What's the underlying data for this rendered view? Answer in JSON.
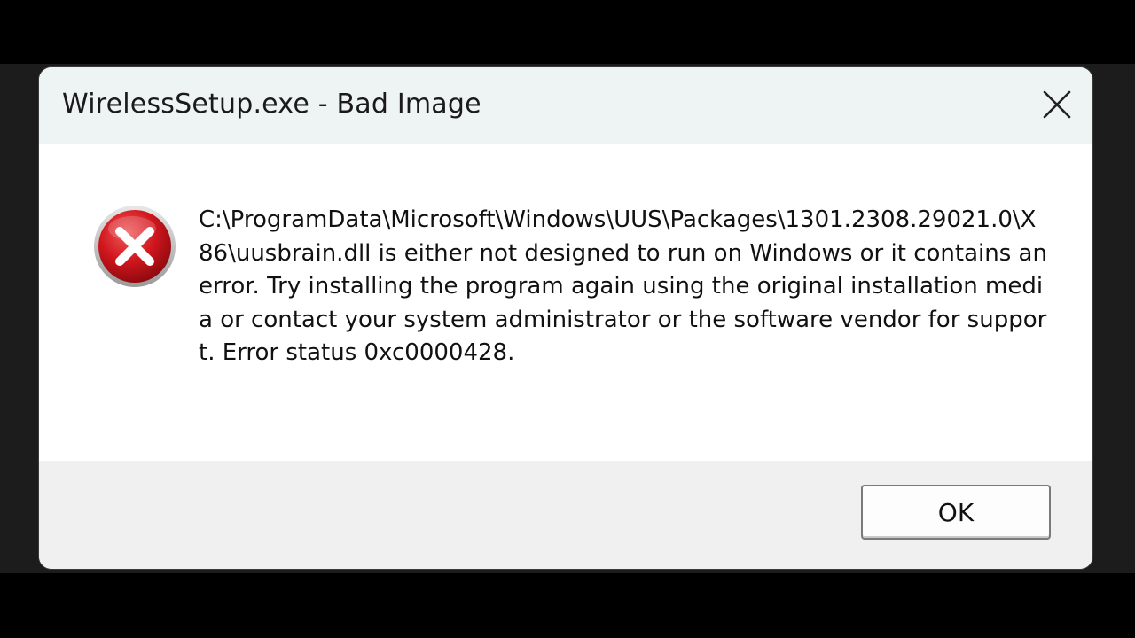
{
  "dialog": {
    "title": "WirelessSetup.exe - Bad Image",
    "icon": "error-icon",
    "message": "C:\\ProgramData\\Microsoft\\Windows\\UUS\\Packages\\1301.2308.29021.0\\X86\\uusbrain.dll is either not designed to run on Windows or it contains an error. Try installing the program again using the original installation media or contact your system administrator or the software vendor for support. Error status 0xc0000428.",
    "ok_label": "OK",
    "close_icon": "close-icon"
  },
  "colors": {
    "titlebar": "#eef4f3",
    "content": "#ffffff",
    "footer": "#f0f0f0",
    "error_red": "#d0161d"
  }
}
